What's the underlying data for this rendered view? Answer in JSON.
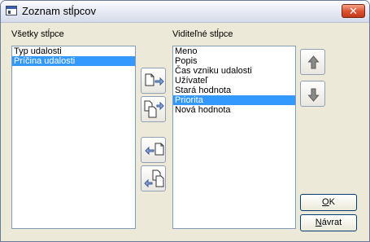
{
  "window": {
    "title": "Zoznam stĺpcov",
    "close_glyph": "✕"
  },
  "all_columns": {
    "label": "Všetky stĺpce",
    "items": [
      {
        "text": "Typ udalosti",
        "selected": false
      },
      {
        "text": "Príčina udalosti",
        "selected": true
      }
    ]
  },
  "visible_columns": {
    "label": "Viditeľné stĺpce",
    "items": [
      {
        "text": "Meno",
        "selected": false
      },
      {
        "text": "Popis",
        "selected": false
      },
      {
        "text": "Čas vzniku udalosti",
        "selected": false
      },
      {
        "text": "Užívateľ",
        "selected": false
      },
      {
        "text": "Stará hodnota",
        "selected": false
      },
      {
        "text": "Priorita",
        "selected": true
      },
      {
        "text": "Nová hodnota",
        "selected": false
      }
    ]
  },
  "transfer_buttons": [
    {
      "name": "add-column-button",
      "icon": "add-one-icon"
    },
    {
      "name": "add-all-columns-button",
      "icon": "add-all-icon"
    },
    {
      "name": "remove-column-button",
      "icon": "remove-one-icon"
    },
    {
      "name": "remove-all-columns-button",
      "icon": "remove-all-icon"
    }
  ],
  "order_buttons": [
    {
      "name": "move-up-button",
      "icon": "arrow-up-icon"
    },
    {
      "name": "move-down-button",
      "icon": "arrow-down-icon"
    }
  ],
  "buttons": {
    "ok": {
      "mnemonic": "O",
      "rest": "K"
    },
    "back": {
      "mnemonic": "N",
      "rest": "ávrat"
    }
  },
  "colors": {
    "selection": "#3399ff",
    "dialog_bg": "#ece9d8",
    "close_red": "#dd5432"
  }
}
